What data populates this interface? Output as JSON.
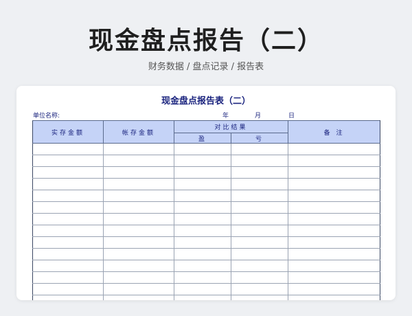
{
  "header": {
    "title": "现金盘点报告（二）",
    "subtitle": "财务数据 / 盘点记录 / 报告表"
  },
  "sheet": {
    "title": "现金盘点报告表（二）",
    "unit_label": "单位名称:",
    "year_label": "年",
    "month_label": "月",
    "day_label": "日",
    "columns": {
      "actual": "实存金额",
      "book": "帐存金额",
      "comparison": "对比结果",
      "surplus": "盈",
      "deficit": "亏",
      "notes": "备 注"
    },
    "rows": [
      [
        "",
        "",
        "",
        "",
        ""
      ],
      [
        "",
        "",
        "",
        "",
        ""
      ],
      [
        "",
        "",
        "",
        "",
        ""
      ],
      [
        "",
        "",
        "",
        "",
        ""
      ],
      [
        "",
        "",
        "",
        "",
        ""
      ],
      [
        "",
        "",
        "",
        "",
        ""
      ],
      [
        "",
        "",
        "",
        "",
        ""
      ],
      [
        "",
        "",
        "",
        "",
        ""
      ],
      [
        "",
        "",
        "",
        "",
        ""
      ],
      [
        "",
        "",
        "",
        "",
        ""
      ],
      [
        "",
        "",
        "",
        "",
        ""
      ],
      [
        "",
        "",
        "",
        "",
        ""
      ],
      [
        "",
        "",
        "",
        "",
        ""
      ],
      [
        "",
        "",
        "",
        "",
        ""
      ]
    ]
  }
}
